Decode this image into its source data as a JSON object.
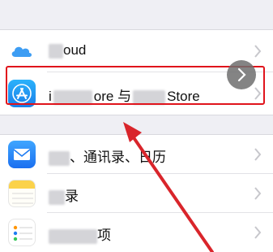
{
  "settings": {
    "rows": [
      {
        "name": "icloud-row",
        "label_visible": "oud",
        "icon": "icloud-icon"
      },
      {
        "name": "itunes-appstore-row",
        "label_prefix": "i",
        "label_mid": "ore 与",
        "label_suffix": "Store",
        "icon": "app-store-icon"
      },
      {
        "name": "mail-contacts-calendar-row",
        "label_visible": "、通讯录、日历",
        "icon": "mail-icon"
      },
      {
        "name": "notes-row",
        "label_visible": "录",
        "icon": "notes-icon"
      },
      {
        "name": "reminders-row",
        "label_visible": "项",
        "icon": "reminders-icon"
      }
    ]
  },
  "colors": {
    "highlight": "#e0141c",
    "arrow": "#d9252b",
    "app_store_blue": "#1a9bf0",
    "mail_blue": "#1e7cf2",
    "notes_yellow": "#fbd24a"
  }
}
